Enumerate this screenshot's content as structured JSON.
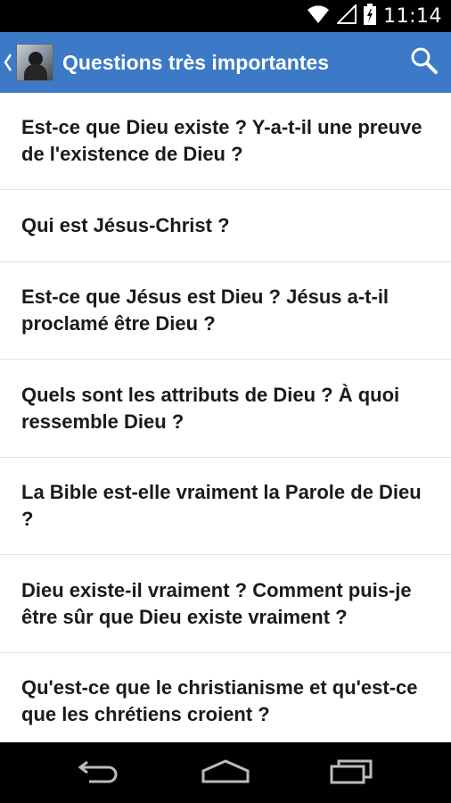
{
  "status_bar": {
    "time": "11:14",
    "icons": [
      "wifi-icon",
      "signal-icon",
      "battery-icon"
    ]
  },
  "action_bar": {
    "title": "Questions très importantes",
    "up_icon": "chevron-left-icon",
    "search_icon": "search-icon"
  },
  "questions": [
    "Est-ce que Dieu existe ? Y-a-t-il une preuve de l'existence de Dieu ?",
    "Qui est Jésus-Christ ?",
    "Est-ce que Jésus est Dieu ? Jésus a-t-il proclamé être Dieu ?",
    "Quels sont les attributs de Dieu ? À quoi ressemble Dieu ?",
    "La Bible est-elle vraiment la Parole de Dieu ?",
    "Dieu existe-il vraiment ? Comment puis-je être sûr que Dieu existe vraiment ?",
    "Qu'est-ce que le christianisme et qu'est-ce que les chrétiens croient ?"
  ],
  "nav_bar": {
    "buttons": [
      "back-icon",
      "home-icon",
      "recents-icon"
    ]
  },
  "colors": {
    "action_bar": "#3c79c7",
    "list_background": "#ffffff",
    "text": "#1a1a1a",
    "divider": "#e3e3e3"
  }
}
